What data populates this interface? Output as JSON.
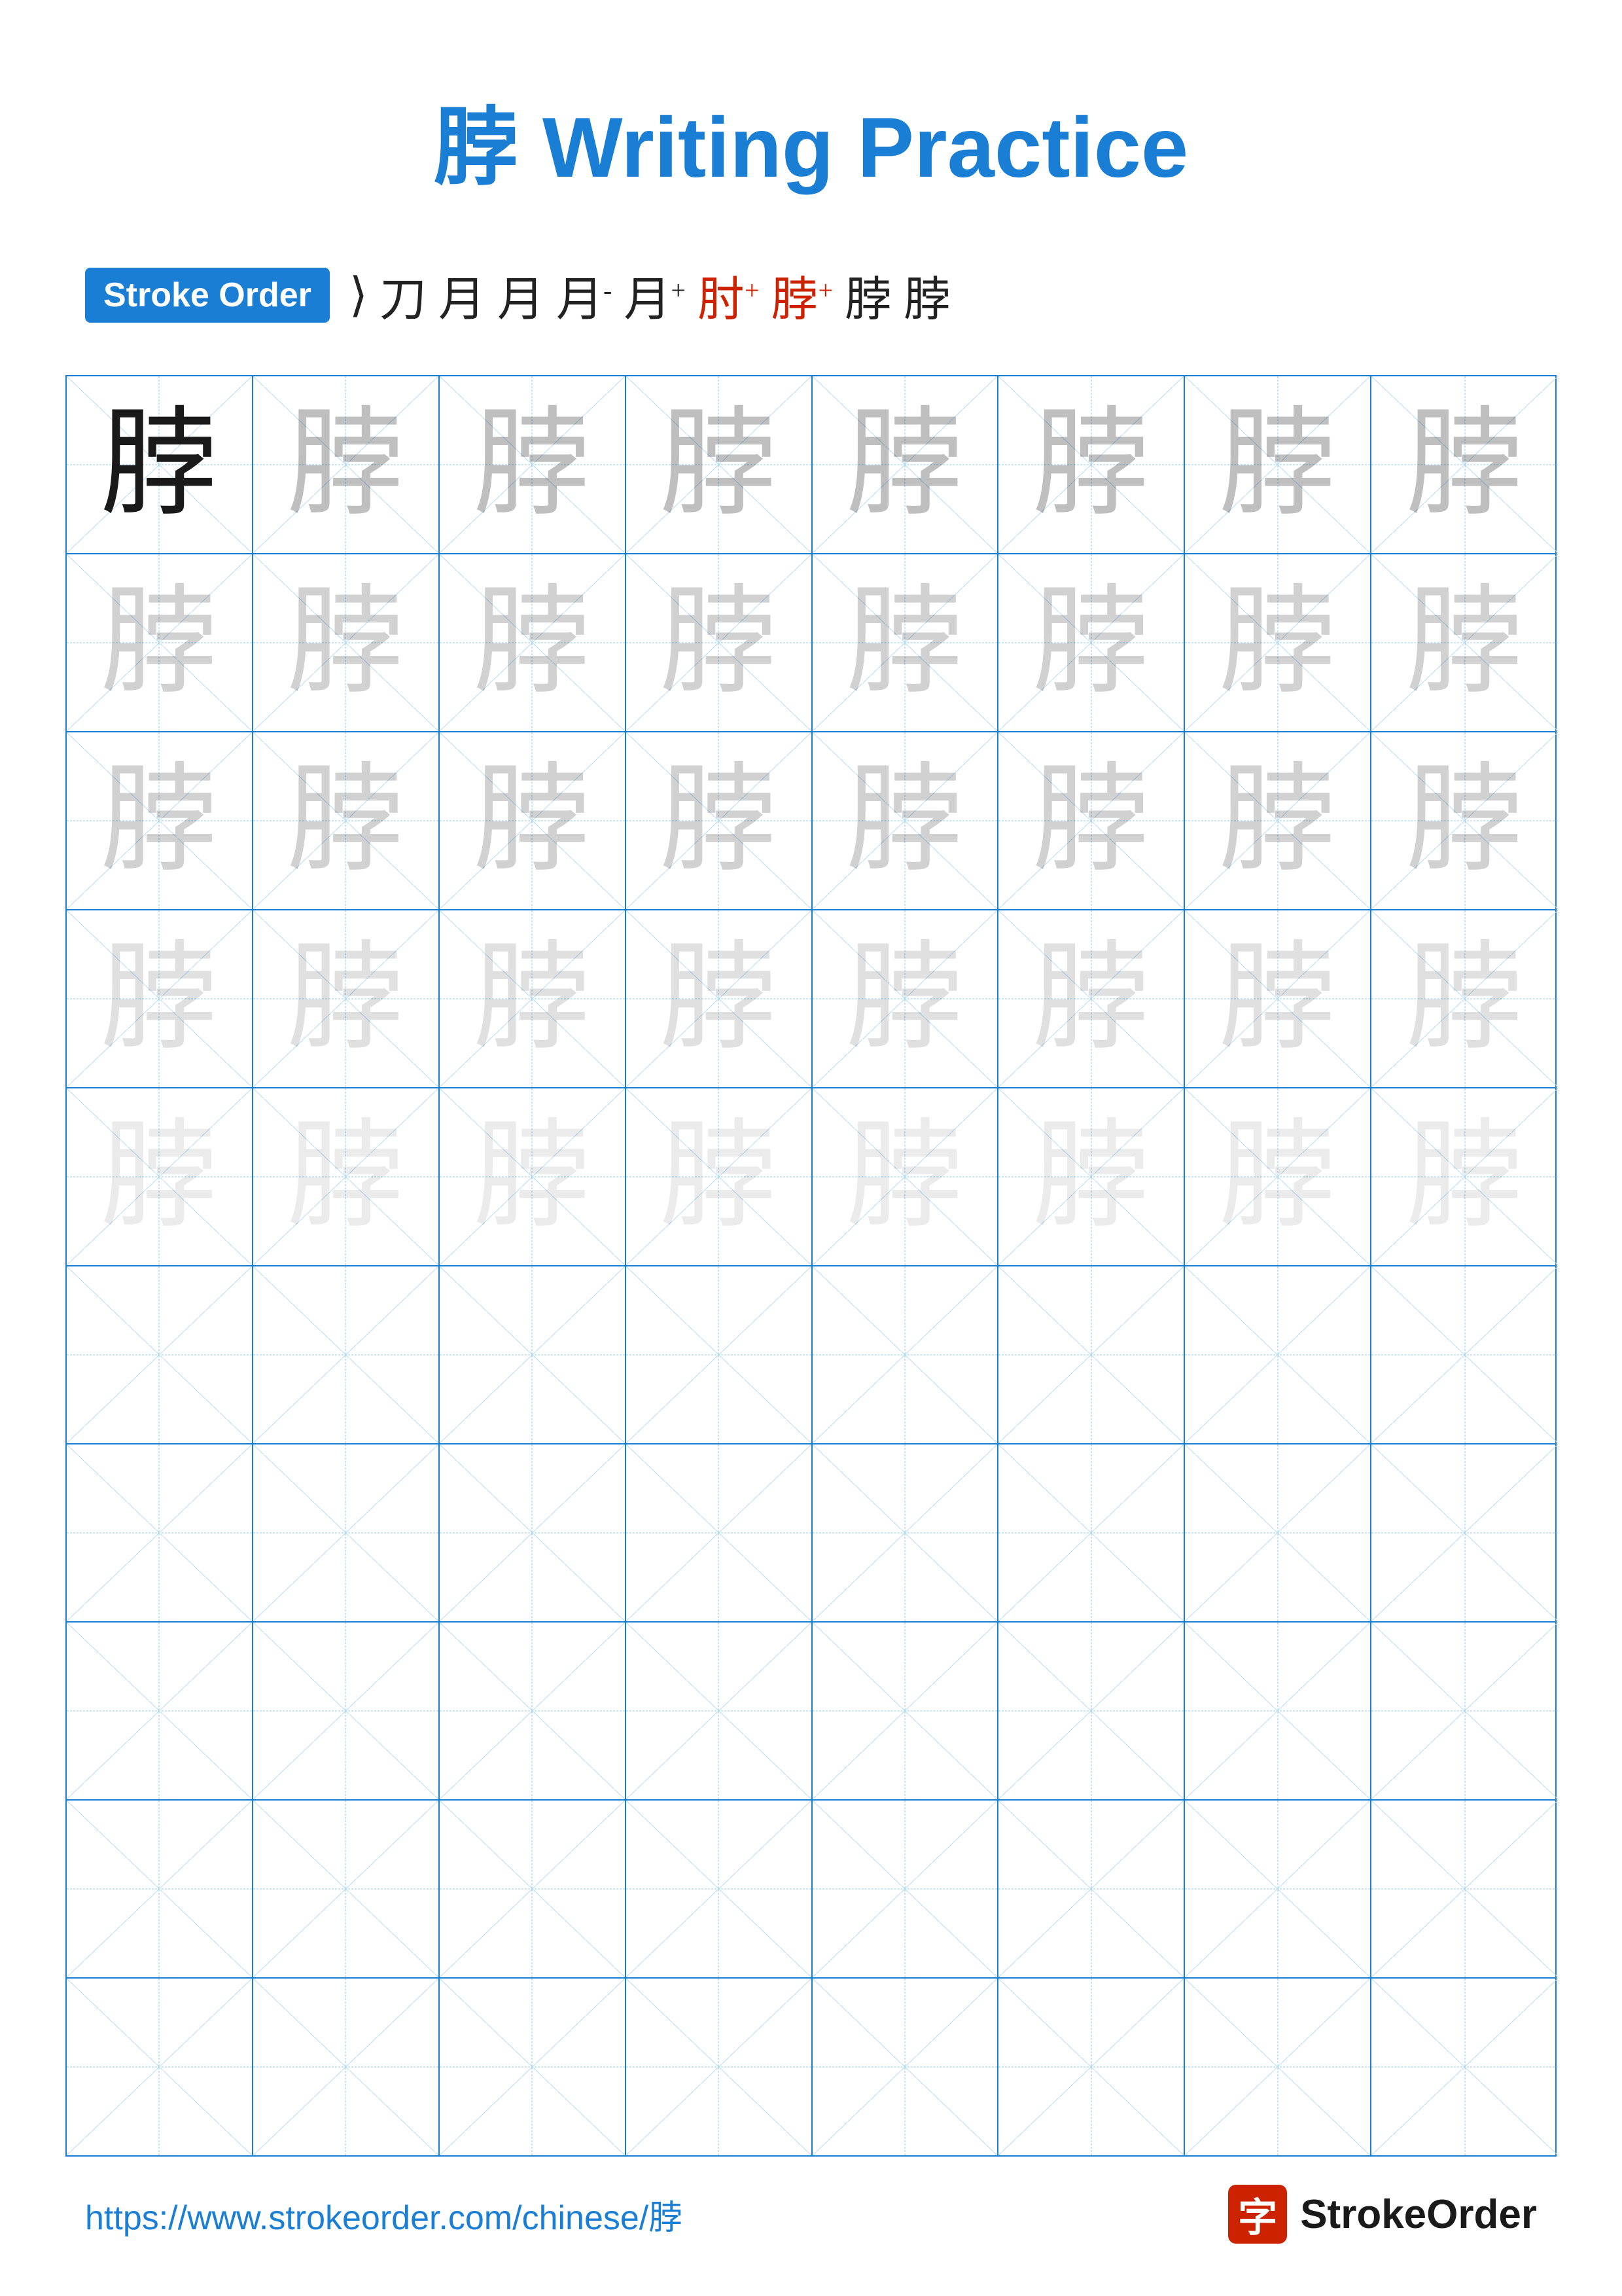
{
  "title": {
    "char": "脖",
    "text": " Writing Practice"
  },
  "stroke_order": {
    "badge_label": "Stroke Order",
    "sequence": [
      ")",
      "刀",
      "月",
      "月",
      "月⁻",
      "月⁺",
      "肘⁺",
      "脖⁺",
      "脖",
      "脖"
    ]
  },
  "grid": {
    "rows": 10,
    "cols": 8,
    "character": "脖"
  },
  "footer": {
    "url": "https://www.strokeorder.com/chinese/脖",
    "brand_icon": "字",
    "brand_name": "StrokeOrder"
  }
}
